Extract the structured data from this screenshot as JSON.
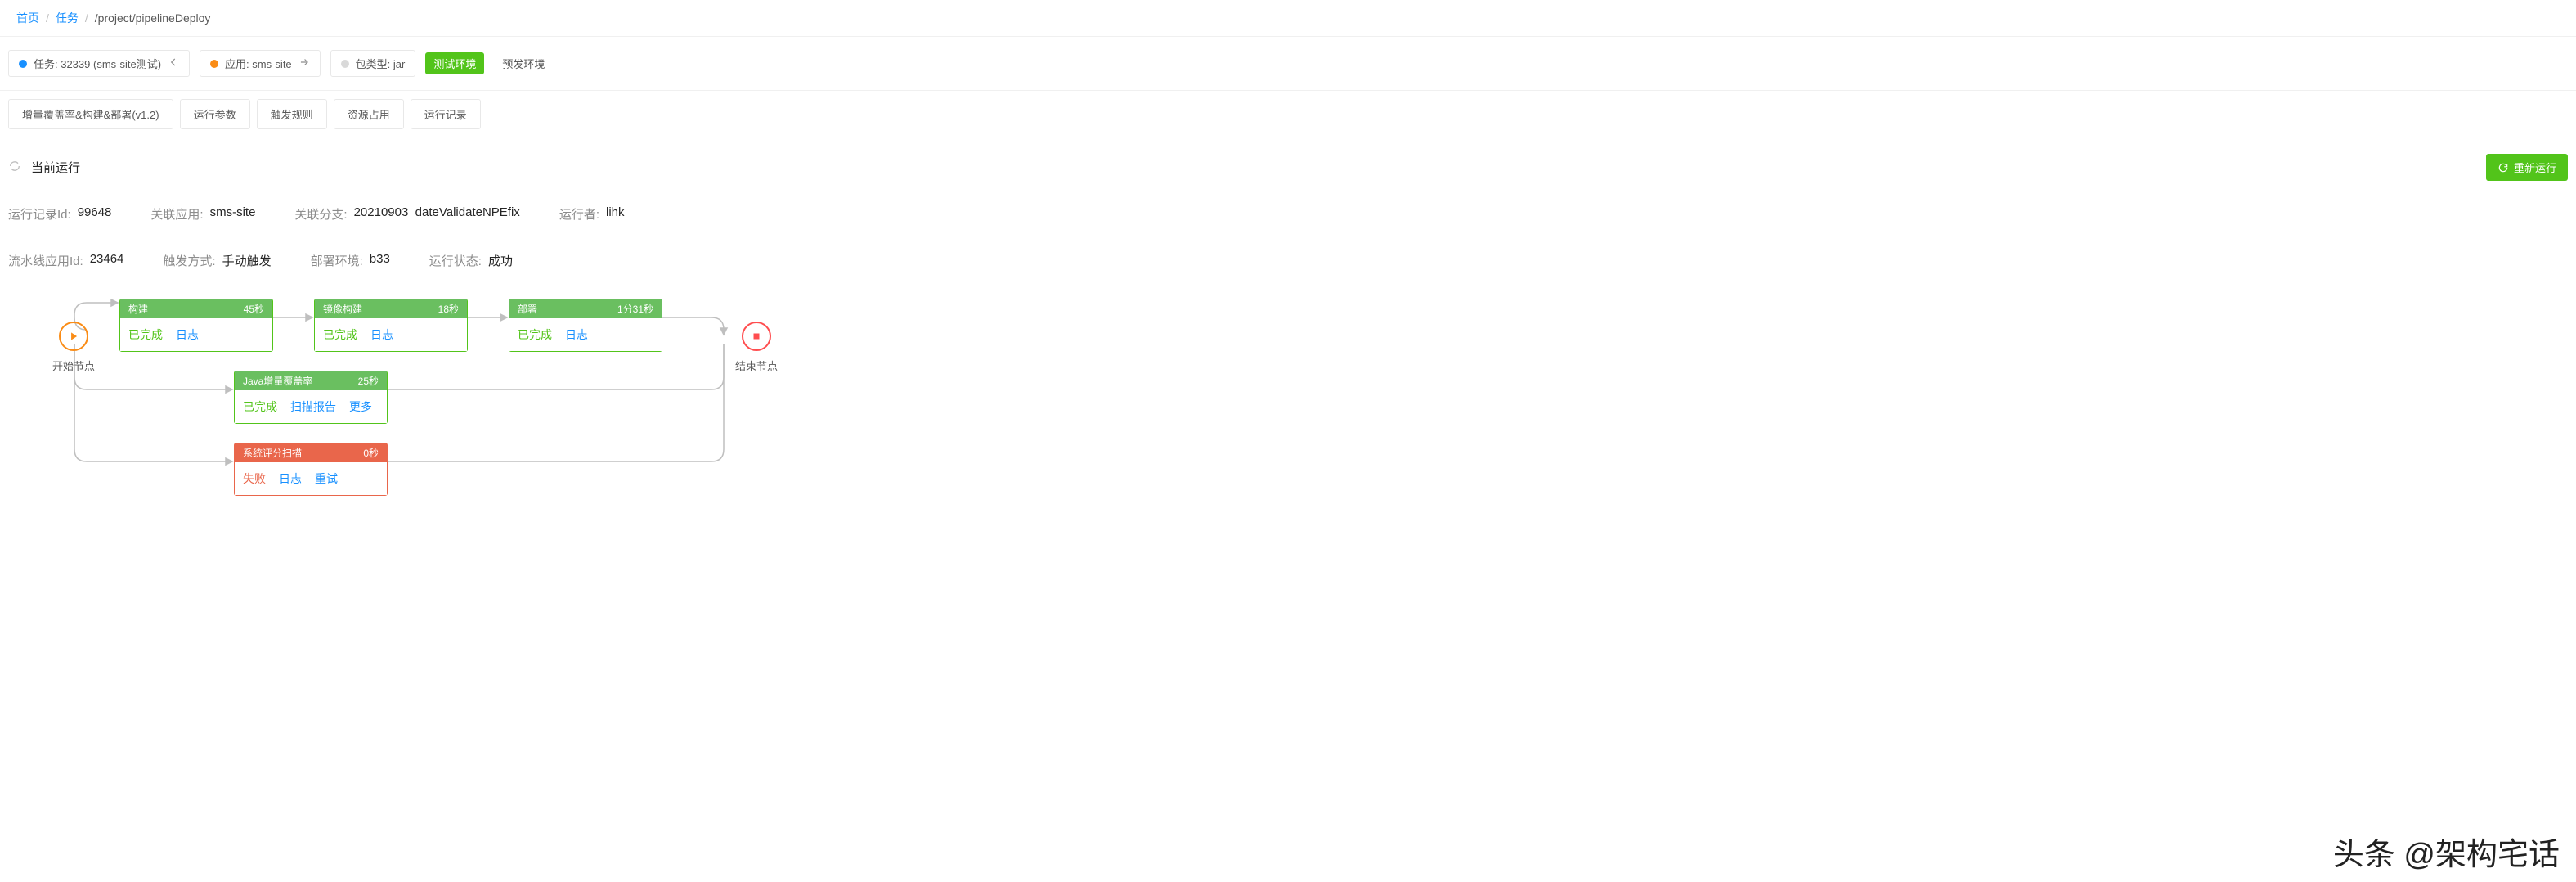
{
  "breadcrumb": {
    "home": "首页",
    "tasks": "任务",
    "path": "/project/pipelineDeploy"
  },
  "tagRow": {
    "task": "任务: 32339 (sms-site测试)",
    "app": "应用: sms-site",
    "pkg": "包类型: jar",
    "env1": "测试环境",
    "env2": "预发环境"
  },
  "tabs": [
    "增量覆盖率&构建&部署(v1.2)",
    "运行参数",
    "触发规则",
    "资源占用",
    "运行记录"
  ],
  "section": {
    "title": "当前运行",
    "rerun": "重新运行"
  },
  "info1": {
    "recordIdLabel": "运行记录Id:",
    "recordId": "99648",
    "appLabel": "关联应用:",
    "app": "sms-site",
    "branchLabel": "关联分支:",
    "branch": "20210903_dateValidateNPEfix",
    "runnerLabel": "运行者:",
    "runner": "lihk"
  },
  "info2": {
    "pipelineIdLabel": "流水线应用Id:",
    "pipelineId": "23464",
    "triggerLabel": "触发方式:",
    "trigger": "手动触发",
    "envLabel": "部署环境:",
    "env": "b33",
    "statusLabel": "运行状态:",
    "status": "成功"
  },
  "nodes": {
    "startLabel": "开始节点",
    "endLabel": "结束节点"
  },
  "stages": {
    "build": {
      "title": "构建",
      "time": "45秒",
      "status": "已完成",
      "link1": "日志"
    },
    "image": {
      "title": "镜像构建",
      "time": "18秒",
      "status": "已完成",
      "link1": "日志"
    },
    "deploy": {
      "title": "部署",
      "time": "1分31秒",
      "status": "已完成",
      "link1": "日志"
    },
    "javacov": {
      "title": "Java增量覆盖率",
      "time": "25秒",
      "status": "已完成",
      "link1": "扫描报告",
      "link2": "更多"
    },
    "scan": {
      "title": "系统评分扫描",
      "time": "0秒",
      "status": "失败",
      "link1": "日志",
      "link2": "重试"
    }
  },
  "watermark": "头条 @架构宅话"
}
